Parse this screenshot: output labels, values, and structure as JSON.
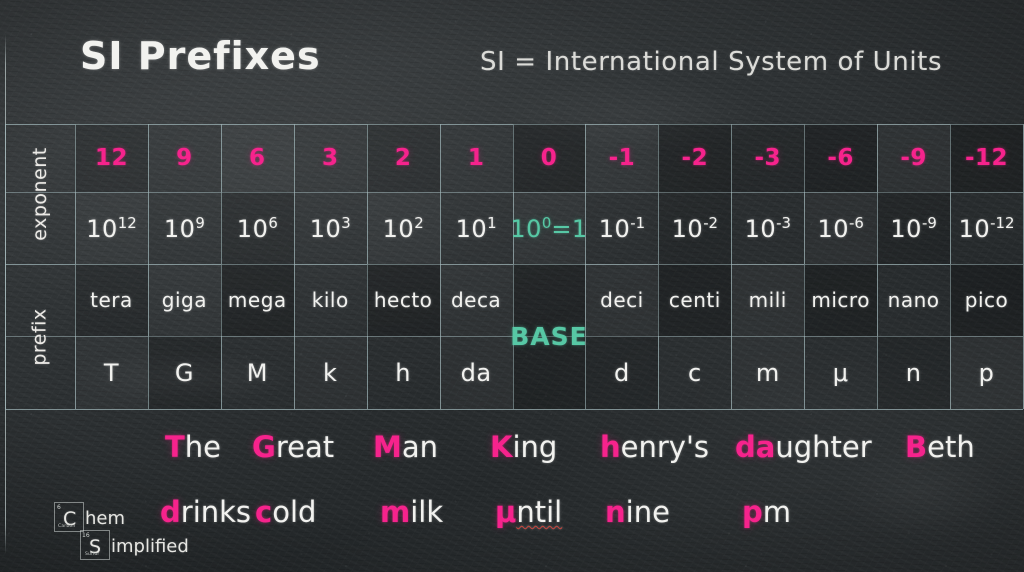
{
  "header": {
    "title": "SI Prefixes",
    "subtitle": "SI = International System of Units"
  },
  "table": {
    "row_labels": {
      "exponent": "exponent",
      "prefix": "prefix"
    },
    "base_label": "BASE",
    "columns": [
      {
        "exponent": "12",
        "power": "10",
        "power_sup": "12",
        "prefix": "tera",
        "symbol": "T"
      },
      {
        "exponent": "9",
        "power": "10",
        "power_sup": "9",
        "prefix": "giga",
        "symbol": "G"
      },
      {
        "exponent": "6",
        "power": "10",
        "power_sup": "6",
        "prefix": "mega",
        "symbol": "M"
      },
      {
        "exponent": "3",
        "power": "10",
        "power_sup": "3",
        "prefix": "kilo",
        "symbol": "k"
      },
      {
        "exponent": "2",
        "power": "10",
        "power_sup": "2",
        "prefix": "hecto",
        "symbol": "h"
      },
      {
        "exponent": "1",
        "power": "10",
        "power_sup": "1",
        "prefix": "deca",
        "symbol": "da"
      },
      {
        "exponent": "0",
        "power": "10",
        "power_sup": "0",
        "power_suffix": "=1",
        "prefix": "",
        "symbol": ""
      },
      {
        "exponent": "-1",
        "power": "10",
        "power_sup": "-1",
        "prefix": "deci",
        "symbol": "d"
      },
      {
        "exponent": "-2",
        "power": "10",
        "power_sup": "-2",
        "prefix": "centi",
        "symbol": "c"
      },
      {
        "exponent": "-3",
        "power": "10",
        "power_sup": "-3",
        "prefix": "mili",
        "symbol": "m"
      },
      {
        "exponent": "-6",
        "power": "10",
        "power_sup": "-6",
        "prefix": "micro",
        "symbol": "μ"
      },
      {
        "exponent": "-9",
        "power": "10",
        "power_sup": "-9",
        "prefix": "nano",
        "symbol": "n"
      },
      {
        "exponent": "-12",
        "power": "10",
        "power_sup": "-12",
        "prefix": "pico",
        "symbol": "p"
      }
    ]
  },
  "mnemonic": {
    "line1": [
      {
        "head": "T",
        "tail": "he"
      },
      {
        "head": "G",
        "tail": "reat"
      },
      {
        "head": "M",
        "tail": "an"
      },
      {
        "head": "K",
        "tail": "ing"
      },
      {
        "head": "h",
        "tail": "enry's"
      },
      {
        "head": "da",
        "tail": "ughter"
      },
      {
        "head": "B",
        "tail": "eth"
      }
    ],
    "line2": [
      {
        "head": "d",
        "tail": "rinks"
      },
      {
        "head": "c",
        "tail": "old"
      },
      {
        "head": "m",
        "tail": "ilk"
      },
      {
        "head": "μ",
        "tail": "ntil",
        "misspelled": true
      },
      {
        "head": "n",
        "tail": "ine"
      },
      {
        "head": "p",
        "tail": "m"
      }
    ]
  },
  "logo": {
    "element1": {
      "symbol": "C",
      "number": "6",
      "name": "Carbon"
    },
    "word1": "hem",
    "element2": {
      "symbol": "S",
      "number": "16",
      "name": "Sulfur"
    },
    "word2": "implified"
  },
  "colors": {
    "chalk_white": "#f2f2ef",
    "pink": "#f6238c",
    "teal": "#57c8a5",
    "grid": "#9fb5b8",
    "board": "#2f3335"
  }
}
